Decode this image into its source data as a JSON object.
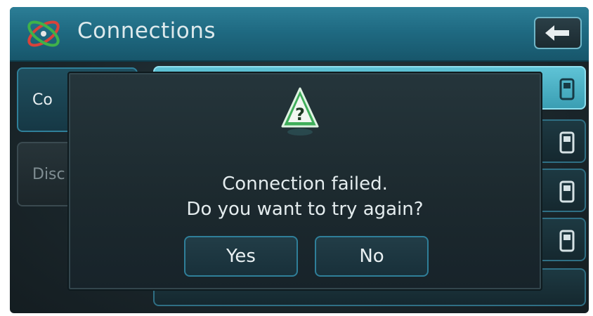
{
  "header": {
    "title": "Connections",
    "logo_icon": "connections-logo-icon",
    "back_icon": "back-arrow-icon"
  },
  "left_menu": {
    "connect_label": "Co",
    "disconnect_label": "Disc"
  },
  "device_list": {
    "rows": [
      {
        "icon": "phone-icon",
        "selected": true
      },
      {
        "icon": "phone-icon",
        "selected": false
      },
      {
        "icon": "phone-icon",
        "selected": false
      },
      {
        "icon": "phone-icon",
        "selected": false
      },
      {
        "icon": "",
        "selected": false
      }
    ]
  },
  "dialog": {
    "icon": "warning-question-icon",
    "message_line1": "Connection failed.",
    "message_line2": "Do you want to try again?",
    "yes_label": "Yes",
    "no_label": "No"
  },
  "colors": {
    "header": "#1f6a82",
    "accent_border": "#2f7f99",
    "selected_row": "#5fc3d6",
    "background": "#1b272c"
  }
}
